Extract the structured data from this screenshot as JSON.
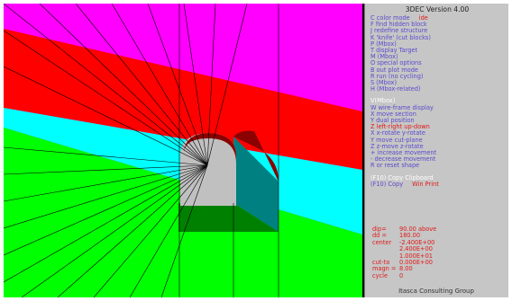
{
  "window": {
    "title": "3DEC Version 4.00",
    "footer": "Itasca Consulting Group"
  },
  "menu": {
    "items": [
      {
        "label": "C color mode",
        "extra": "ide",
        "color": "purple"
      },
      {
        "label": "F find hidden block",
        "color": "purple"
      },
      {
        "label": "J redefine structure",
        "color": "purple"
      },
      {
        "label": "K 'knife' (cut blocks)",
        "color": "purple"
      },
      {
        "label": "P (Mbox)",
        "color": "purple"
      },
      {
        "label": "T display Target",
        "color": "purple"
      },
      {
        "label": "M (Mbox)",
        "color": "purple"
      },
      {
        "label": "O special options",
        "color": "purple"
      },
      {
        "label": "B out plot mode",
        "color": "purple"
      },
      {
        "label": "R run (no cycling)",
        "color": "purple"
      },
      {
        "label": "S (Mbox)",
        "color": "purple"
      },
      {
        "label": "H (Mbox-related)",
        "color": "purple"
      },
      {
        "label": "V(Mbox)",
        "color": "white"
      },
      {
        "label": "W wire-frame display",
        "color": "purple"
      },
      {
        "label": "X move section",
        "color": "purple"
      },
      {
        "label": "Y dual position",
        "color": "purple"
      },
      {
        "label": "Z left-right up-down",
        "color": "red"
      },
      {
        "label": "X x-rotate y-rotate",
        "color": "purple"
      },
      {
        "label": "Y move cut-plane",
        "color": "purple"
      },
      {
        "label": "Z z-move z-rotate",
        "color": "purple"
      },
      {
        "label": "+ increase movement",
        "color": "purple"
      },
      {
        "label": "- decrease movement",
        "color": "purple"
      },
      {
        "label": "R or reset shape",
        "color": "purple"
      },
      {
        "label": "(F10) Copy Clipboard",
        "color": "white"
      },
      {
        "label": "(F10) Copy",
        "extra": "Win Print",
        "color": "purple"
      }
    ]
  },
  "readout": [
    {
      "label": "dip=",
      "value": "90.00 above"
    },
    {
      "label": "dd =",
      "value": "180.00"
    },
    {
      "label": "center",
      "value": "-2.400E+00"
    },
    {
      "label": "",
      "value": "2.400E+00"
    },
    {
      "label": "",
      "value": "1.000E+01"
    },
    {
      "label": "cut-to",
      "value": "0.000E+00"
    },
    {
      "label": "magn =",
      "value": "8.00"
    },
    {
      "label": "cycle",
      "value": "0"
    }
  ],
  "viewport": {
    "colors": {
      "upper_region": "#ff00ff",
      "red_layer": "#ff0000",
      "cyan_layer": "#00ffff",
      "lower_region": "#00ff00",
      "tunnel_face": "#c0c0c0",
      "tunnel_roof": "#8b0000",
      "tunnel_side": "#008080",
      "tunnel_floor": "#008000",
      "wireframe": "#000000"
    }
  }
}
